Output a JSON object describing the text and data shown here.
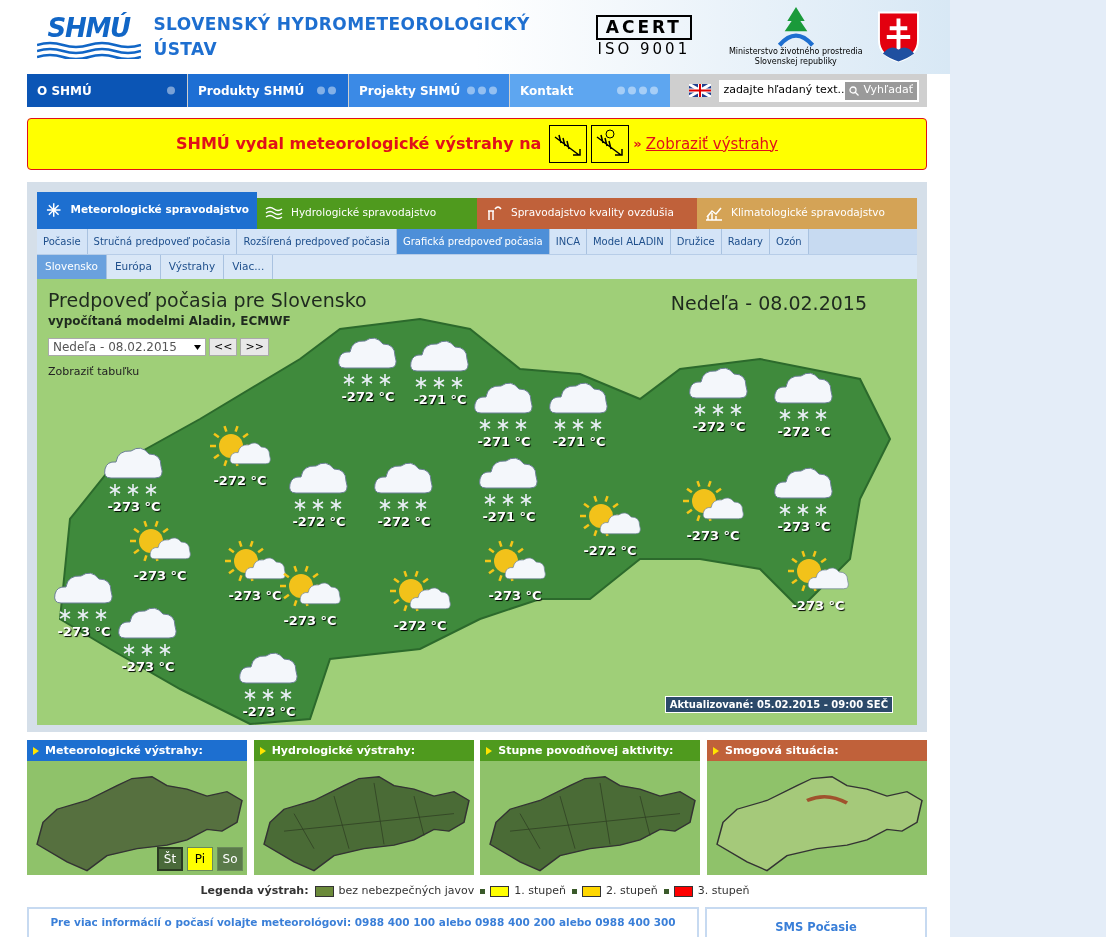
{
  "header": {
    "title": "SLOVENSKÝ HYDROMETEOROLOGICKÝ ÚSTAV",
    "logo_text": "SHMÚ",
    "cert_name": "ACERT",
    "cert_standard": "ISO 9001",
    "ministry": "Ministerstvo životného prostredia Slovenskej republiky"
  },
  "nav": [
    {
      "label": "O SHMÚ",
      "color": "#0b55b5"
    },
    {
      "label": "Produkty SHMÚ",
      "color": "#1e6fd4"
    },
    {
      "label": "Projekty SHMÚ",
      "color": "#3b8ae6"
    },
    {
      "label": "Kontakt",
      "color": "#5ea6f0"
    }
  ],
  "search": {
    "placeholder": "zadajte hľadaný text...",
    "button": "Vyhľadať"
  },
  "alert": {
    "text": "SHMÚ vydal meteorologické výstrahy na",
    "link_prefix": "»",
    "link": "Zobraziť výstrahy"
  },
  "category_tabs": [
    {
      "label": "Meteorologické spravodajstvo",
      "selected": true,
      "color": "#1d6fd0"
    },
    {
      "label": "Hydrologické spravodajstvo",
      "selected": false,
      "color": "#4f9a1e"
    },
    {
      "label": "Spravodajstvo kvality ovzdušia",
      "selected": false,
      "color": "#c0613a"
    },
    {
      "label": "Klimatologické spravodajstvo",
      "selected": false,
      "color": "#d4a356"
    }
  ],
  "sub_tabs": [
    {
      "label": "Počasie",
      "selected": false
    },
    {
      "label": "Stručná predpoveď počasia",
      "selected": false
    },
    {
      "label": "Rozšírená predpoveď počasia",
      "selected": false
    },
    {
      "label": "Grafická predpoveď počasia",
      "selected": true
    },
    {
      "label": "INCA",
      "selected": false
    },
    {
      "label": "Model ALADIN",
      "selected": false
    },
    {
      "label": "Družice",
      "selected": false
    },
    {
      "label": "Radary",
      "selected": false
    },
    {
      "label": "Ozón",
      "selected": false
    }
  ],
  "region_tabs": [
    {
      "label": "Slovensko",
      "selected": true
    },
    {
      "label": "Európa",
      "selected": false
    },
    {
      "label": "Výstrahy",
      "selected": false
    },
    {
      "label": "Viac...",
      "selected": false
    }
  ],
  "forecast": {
    "title": "Predpoveď počasia pre Slovensko",
    "subtitle": "vypočítaná modelmi Aladin, ECMWF",
    "date": "Nedeľa - 08.02.2015",
    "select_value": "Nedeľa - 08.02.2015",
    "prev": "<<",
    "next": ">>",
    "table_link": "Zobraziť tabuľku",
    "updated": "Aktualizované: 05.02.2015 - 09:00 SEČ",
    "markers": [
      {
        "kind": "snow",
        "temp": "-272 °C"
      },
      {
        "kind": "snow",
        "temp": "-271 °C"
      },
      {
        "kind": "snow",
        "temp": "-271 °C"
      },
      {
        "kind": "snow",
        "temp": "-271 °C"
      },
      {
        "kind": "snow",
        "temp": "-272 °C"
      },
      {
        "kind": "snow",
        "temp": "-272 °C"
      },
      {
        "kind": "sun",
        "temp": "-272 °C"
      },
      {
        "kind": "snow",
        "temp": "-273 °C"
      },
      {
        "kind": "snow",
        "temp": "-272 °C"
      },
      {
        "kind": "snow",
        "temp": "-272 °C"
      },
      {
        "kind": "snow",
        "temp": "-271 °C"
      },
      {
        "kind": "sun",
        "temp": "-273 °C"
      },
      {
        "kind": "sun",
        "temp": "-272 °C"
      },
      {
        "kind": "sun",
        "temp": "-273 °C"
      },
      {
        "kind": "snow",
        "temp": "-273 °C"
      },
      {
        "kind": "sun",
        "temp": "-273 °C"
      },
      {
        "kind": "sun",
        "temp": "-273 °C"
      },
      {
        "kind": "sun",
        "temp": "-272 °C"
      },
      {
        "kind": "sun",
        "temp": "-273 °C"
      },
      {
        "kind": "sun",
        "temp": "-273 °C"
      },
      {
        "kind": "snow",
        "temp": "-273 °C"
      },
      {
        "kind": "snow",
        "temp": "-273 °C"
      },
      {
        "kind": "snow",
        "temp": "-273 °C"
      }
    ]
  },
  "panels": [
    {
      "title": "Meteorologické výstrahy:",
      "color": "#1d6fd0",
      "kind": "outline",
      "days": [
        {
          "label": "Št",
          "selected": true,
          "color": "#4a6a3a"
        },
        {
          "label": "Pi",
          "selected": false,
          "color": "#ffff00"
        },
        {
          "label": "So",
          "selected": false,
          "color": "#5a7a4a"
        }
      ]
    },
    {
      "title": "Hydrologické výstrahy:",
      "color": "#4f9a1e",
      "kind": "districts"
    },
    {
      "title": "Stupne povodňovej aktivity:",
      "color": "#4f9a1e",
      "kind": "districts"
    },
    {
      "title": "Smogová situácia:",
      "color": "#c0613a",
      "kind": "relief"
    }
  ],
  "legend": {
    "label": "Legenda výstrah:",
    "items": [
      {
        "label": "bez nebezpečných javov",
        "color": "#6b8a3a"
      },
      {
        "label": "1. stupeň",
        "color": "#ffff00"
      },
      {
        "label": "2. stupeň",
        "color": "#ffd700"
      },
      {
        "label": "3. stupeň",
        "color": "#ff0000"
      }
    ]
  },
  "info": {
    "text": "Pre viac informácií o počasí volajte meteorológovi: 0988 400 100 alebo 0988 400 200 alebo 0988 400 300",
    "sms": "SMS Počasie"
  }
}
